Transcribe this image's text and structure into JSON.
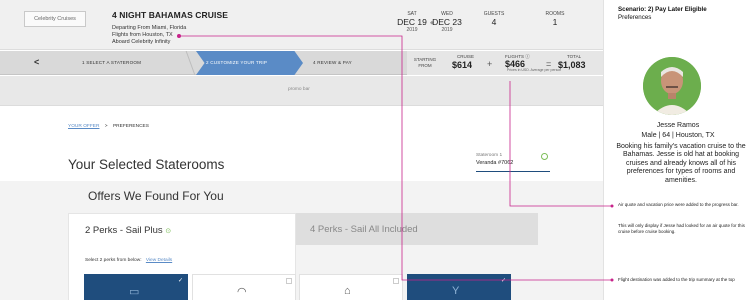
{
  "header": {
    "logo": "Celebrity Cruises",
    "cruise_title": "4 NIGHT BAHAMAS CRUISE",
    "departing": "Departing From Miami, Florida",
    "flights": "Flights from Houston, TX",
    "ship": "Aboard Celebrity Infinity",
    "dates": [
      {
        "dow": "SAT",
        "date": "DEC 19",
        "year": "2019"
      },
      {
        "dow": "WED",
        "date": "DEC 23",
        "year": "2019"
      }
    ],
    "guests_label": "GUESTS",
    "guests_value": "4",
    "rooms_label": "ROOMS",
    "rooms_value": "1"
  },
  "progress": {
    "back": "<",
    "steps": [
      "1   SELECT A STATEROOM",
      "2   CUSTOMIZE YOUR TRIP",
      "4   REVIEW & PAY"
    ],
    "starting_label": "STARTING\nFROM",
    "cruise_label": "CRUISE",
    "cruise_value": "$614",
    "flights_label": "FLIGHTS ⓘ",
    "flights_value": "$466",
    "total_label": "TOTAL",
    "total_value": "$1,083",
    "plus": "+",
    "equals": "=",
    "note": "Prices in USD. Average per person"
  },
  "promo": "promo bar",
  "breadcrumb": {
    "link": "YOUR OFFER",
    "sep": ">",
    "current": "PREFERENCES"
  },
  "section_title": "Your Selected Staterooms",
  "stateroom": {
    "label": "Stateroom 1",
    "value": "Veranda #7062"
  },
  "offers": {
    "title": "Offers We Found For You",
    "tab1": "2 Perks - Sail Plus",
    "tab2": "4 Perks - Sail All Included",
    "select_text": "Select 2 perks from below:",
    "view_details": "View Details"
  },
  "panel": {
    "title": "Scenario: 2) Pay Later Eligible",
    "subtitle": "Preferences",
    "name": "Jesse Ramos",
    "meta": "Male | 64 | Houston, TX",
    "bio": "Booking his family's vacation cruise to the Bahamas. Jesse is old hat at booking cruises and already knows all of his preferences for types of rooms and amenities.",
    "note1": "Air quote and vacation price were added to the progress bar.",
    "note2": "This will only display if Jesse had looked for an air quote for this cruise before cruise booking.",
    "note3": "Flight destination was added to the trip summary at the top"
  },
  "colors": {
    "accent": "#5a8bc6",
    "navy": "#1f4d7d",
    "connector": "#c7238a",
    "avatar_bg": "#6cae4d"
  },
  "icons": [
    "check-icon",
    "wifi-icon",
    "waiter-icon",
    "cocktail-icon",
    "info-icon"
  ]
}
